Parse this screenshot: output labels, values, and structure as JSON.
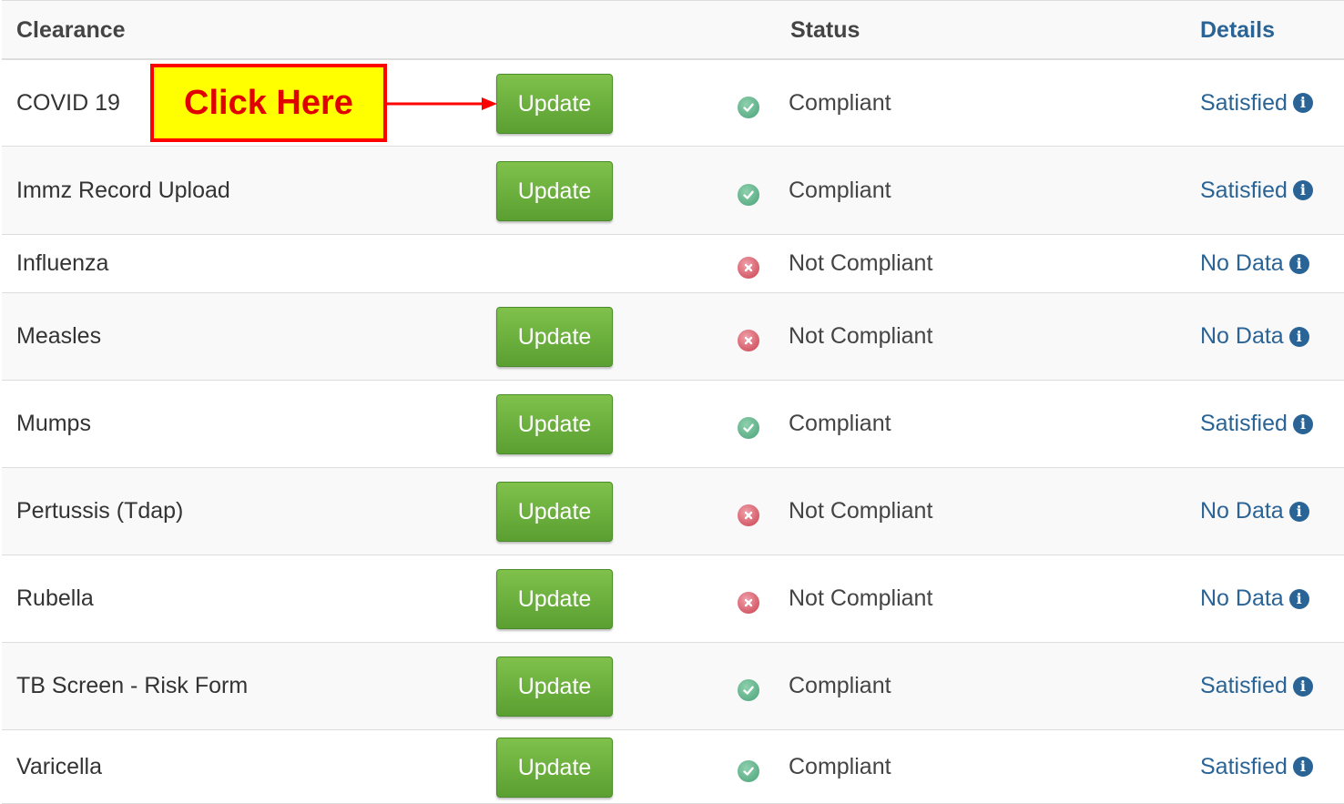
{
  "header": {
    "clearance": "Clearance",
    "status": "Status",
    "details": "Details"
  },
  "callout": {
    "text": "Click Here",
    "color_text": "#e00000",
    "color_fill": "#ffff00",
    "color_border": "#ff0000"
  },
  "colors": {
    "update_button": "#6ab03c",
    "details_link": "#2a6496",
    "compliant_icon": "#4aa27a",
    "not_compliant_icon": "#c9404e"
  },
  "rows": [
    {
      "name": "COVID 19",
      "button": "Update",
      "status_icon": "check-circle-icon",
      "status": "Compliant",
      "details": "Satisfied"
    },
    {
      "name": "Immz Record Upload",
      "button": "Update",
      "status_icon": "check-circle-icon",
      "status": "Compliant",
      "details": "Satisfied"
    },
    {
      "name": "Influenza",
      "button": "",
      "status_icon": "x-circle-icon",
      "status": "Not Compliant",
      "details": "No Data"
    },
    {
      "name": "Measles",
      "button": "Update",
      "status_icon": "x-circle-icon",
      "status": "Not Compliant",
      "details": "No Data"
    },
    {
      "name": "Mumps",
      "button": "Update",
      "status_icon": "check-circle-icon",
      "status": "Compliant",
      "details": "Satisfied"
    },
    {
      "name": "Pertussis (Tdap)",
      "button": "Update",
      "status_icon": "x-circle-icon",
      "status": "Not Compliant",
      "details": "No Data"
    },
    {
      "name": "Rubella",
      "button": "Update",
      "status_icon": "x-circle-icon",
      "status": "Not Compliant",
      "details": "No Data"
    },
    {
      "name": "TB Screen - Risk Form",
      "button": "Update",
      "status_icon": "check-circle-icon",
      "status": "Compliant",
      "details": "Satisfied"
    },
    {
      "name": "Varicella",
      "button": "Update",
      "status_icon": "check-circle-icon",
      "status": "Compliant",
      "details": "Satisfied"
    }
  ]
}
